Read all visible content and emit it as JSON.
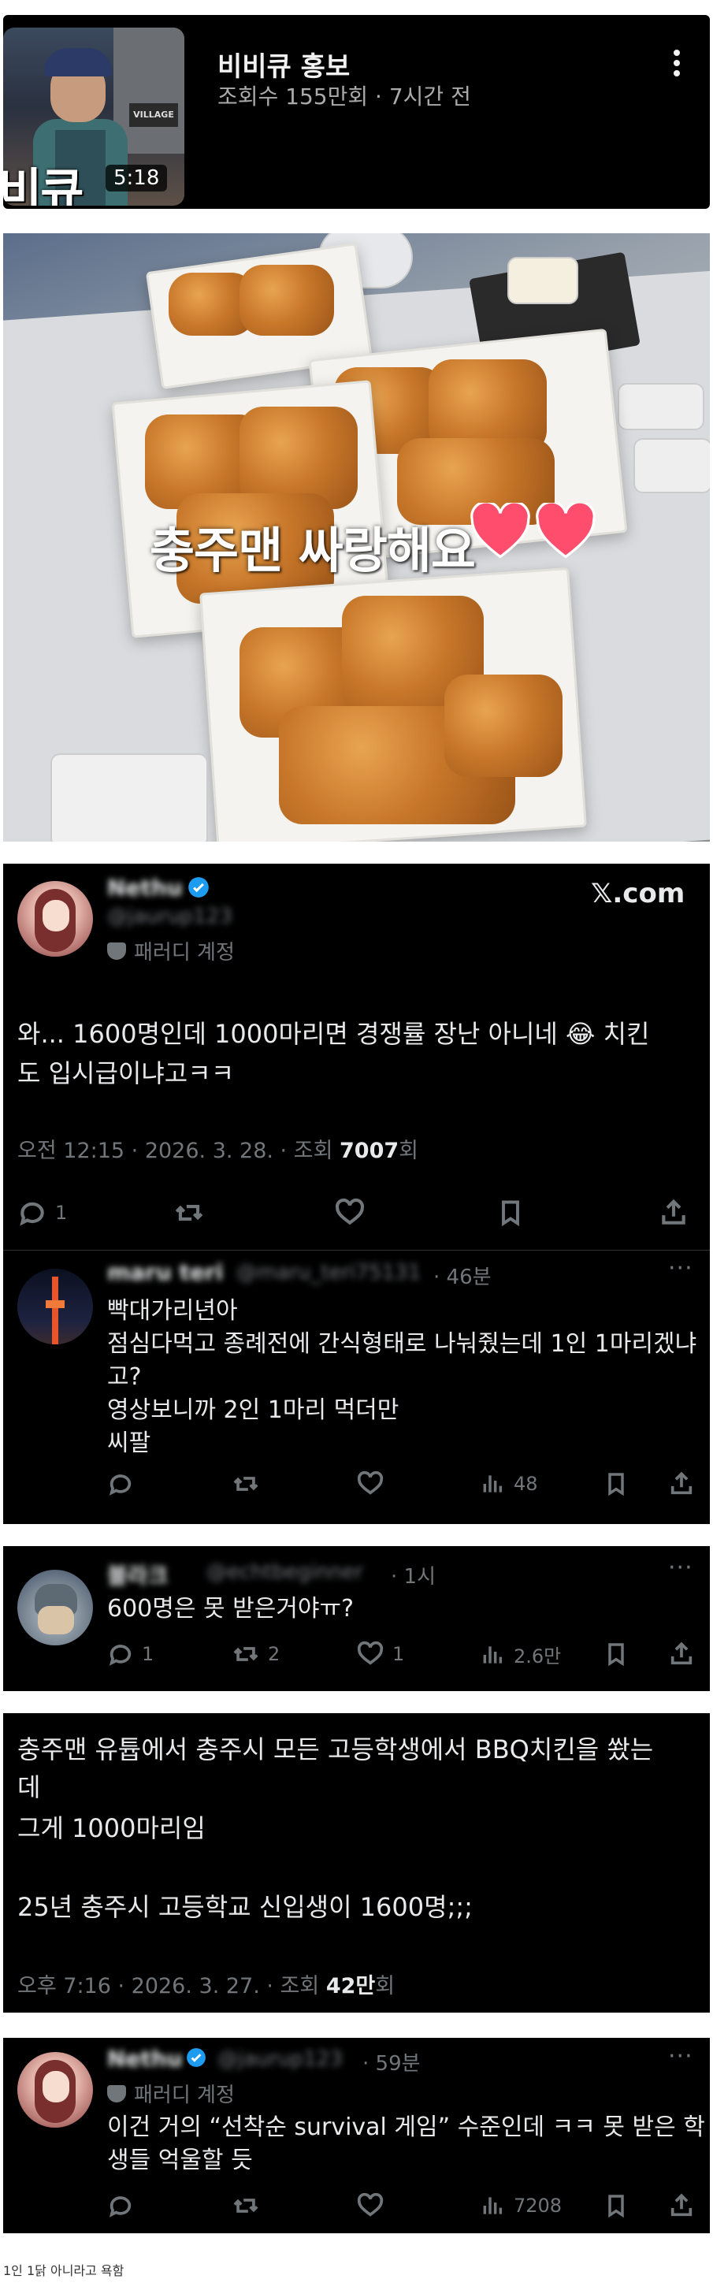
{
  "youtube": {
    "thumb_text": "비큐",
    "thumb_sign": "VILLAGE",
    "duration": "5:18",
    "title": "비비큐 홍보",
    "meta": "조회수 155만회 · 7시간 전"
  },
  "photo": {
    "caption": "충주맨 싸랑해요"
  },
  "tweet1": {
    "name": "Nethu",
    "handle": "@jaurup123",
    "badge": "패러디 계정",
    "brand": "𝕏.com",
    "text_line1": "와... 1600명인데 1000마리면 경쟁률 장난 아니네 😂 치킨",
    "text_line2": "도 입시급이냐고ㅋㅋ",
    "time": "오전 12:15 · 2026. 3. 28. · 조회 ",
    "views": "7007",
    "views_suffix": "회",
    "reply_count": "1"
  },
  "reply1": {
    "name": "maru teri",
    "handle": "@maru_teri75131",
    "age": "· 46분",
    "lines": [
      "빡대가리년아",
      "점심다먹고 종례전에 간식형태로 나눠줬는데 1인 1마리겠냐",
      "고?",
      "영상보니까 2인 1마리 먹더만",
      "씨팔"
    ],
    "views": "48"
  },
  "reply2": {
    "name": "블라크",
    "handle": "@echtbeginner",
    "age": "· 1시",
    "text": "600명은 못 받은거야ㅠ?",
    "reply_count": "1",
    "retweet_count": "2",
    "like_count": "1",
    "views": "2.6만"
  },
  "tweet2": {
    "lines": [
      "충주맨 유튭에서 충주시 모든 고등학생에서 BBQ치킨을 쐈는",
      "데",
      "그게 1000마리임",
      "",
      "25년 충주시 고등학교 신입생이 1600명;;;"
    ],
    "time": "오후 7:16 · 2026. 3. 27. · 조회 ",
    "views": "42만",
    "views_suffix": "회"
  },
  "reply3": {
    "name": "Nethu",
    "handle": "@jaurup123",
    "age": "· 59분",
    "badge": "패러디 계정",
    "line1": "이건 거의 “선착순 survival 게임” 수준인데 ㅋㅋ 못 받은 학",
    "line2": "생들 억울할 듯",
    "views": "7208"
  },
  "footnote": "1인 1닭 아니라고 욕함",
  "colors": {
    "tweet_bg": "#000000",
    "text": "#e7e9ea",
    "muted": "#71767b",
    "verified": "#1d9bf0",
    "heart": "#ff4d6d"
  }
}
